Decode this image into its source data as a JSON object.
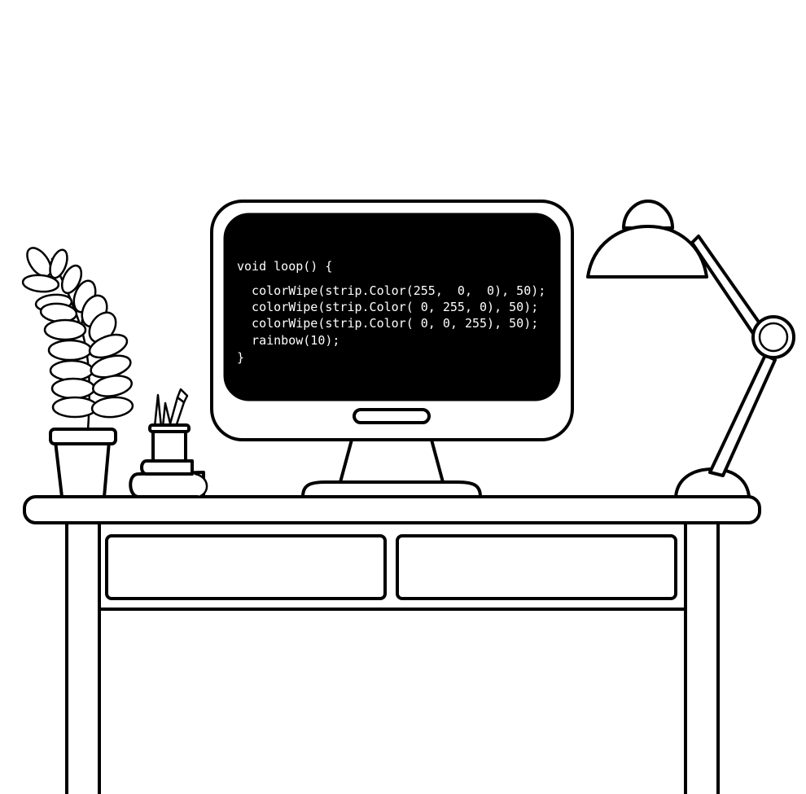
{
  "screen": {
    "background": "#000000",
    "text_color": "#ffffff",
    "code": [
      "void loop() {",
      "  colorWipe(strip.Color(255,  0,  0), 50);",
      "  colorWipe(strip.Color( 0, 255, 0), 50);",
      "  colorWipe(strip.Color( 0, 0, 255), 50);",
      "  rainbow(10);",
      "}"
    ]
  },
  "objects": {
    "plant": "potted-plant",
    "pencil_cup": "pencil-cup-icon",
    "books": "book-stack",
    "monitor": "computer-monitor",
    "lamp": "desk-lamp",
    "desk": "desk-with-two-drawers"
  },
  "colors": {
    "ink": "#000000",
    "paper": "#ffffff"
  }
}
